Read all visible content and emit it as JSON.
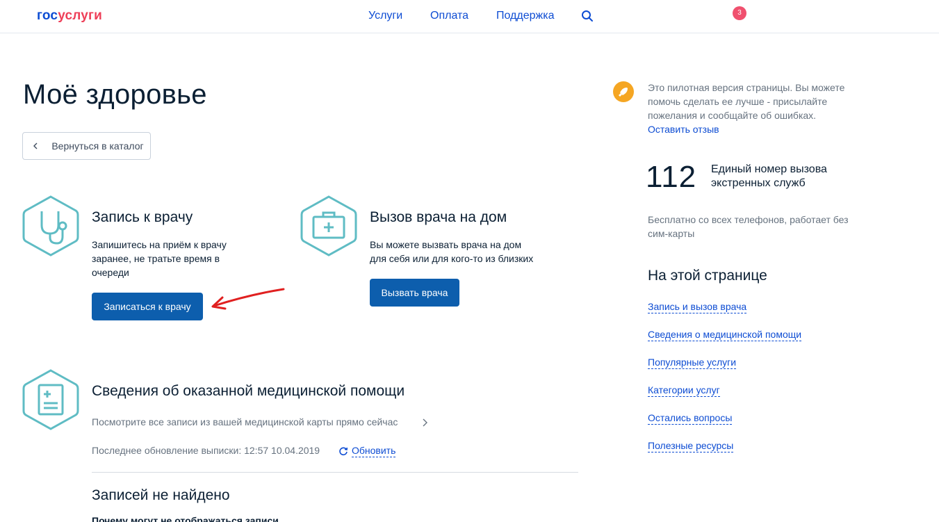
{
  "header": {
    "logo_part1": "гос",
    "logo_part2": "услуги",
    "nav": [
      "Услуги",
      "Оплата",
      "Поддержка"
    ],
    "notification_count": "3",
    "search_icon": "search-icon"
  },
  "main": {
    "title": "Моё здоровье",
    "back_label": "Вернуться в каталог",
    "cards": [
      {
        "icon": "stethoscope-icon",
        "title": "Запись к врачу",
        "desc_lines": [
          "Запишитесь на приём к врачу",
          "заранее, не тратьте время в",
          "очереди"
        ],
        "button": "Записаться к врачу"
      },
      {
        "icon": "medkit-icon",
        "title": "Вызов врача на дом",
        "desc_lines": [
          "Вы можете вызвать врача на дом",
          "для себя или для кого-то из близких"
        ],
        "button": "Вызвать врача"
      }
    ],
    "records": {
      "icon": "medical-document-icon",
      "title": "Сведения об оказанной медицинской помощи",
      "link": "Посмотрите все записи из вашей медицинской карты прямо сейчас",
      "update_label": "Последнее обновление выписки: 12:57 10.04.2019",
      "refresh": "Обновить",
      "none_title": "Записей не найдено",
      "cut_text": "Почему могут не отображаться записи"
    }
  },
  "sidebar": {
    "pilot_text": "Это пилотная версия страницы. Вы можете помочь сделать ее лучше - присылайте пожелания и сообщайте об ошибках.",
    "pilot_link": "Оставить отзыв",
    "emergency_number": "112",
    "emergency_label": "Единый номер вызова экстренных служб",
    "free_text": "Бесплатно со всех телефонов, работает без сим-карты",
    "toc_title": "На этой странице",
    "toc": [
      "Запись и вызов врача",
      "Сведения о медицинской помощи",
      "Популярные услуги",
      "Категории услуг",
      "Остались вопросы",
      "Полезные ресурсы"
    ]
  },
  "colors": {
    "primary": "#0d5ead",
    "link": "#0d4cd3",
    "icon_teal": "#5fbcc4",
    "annotation_arrow": "#e02020",
    "badge": "#f0506e",
    "rocket": "#f5a623"
  }
}
